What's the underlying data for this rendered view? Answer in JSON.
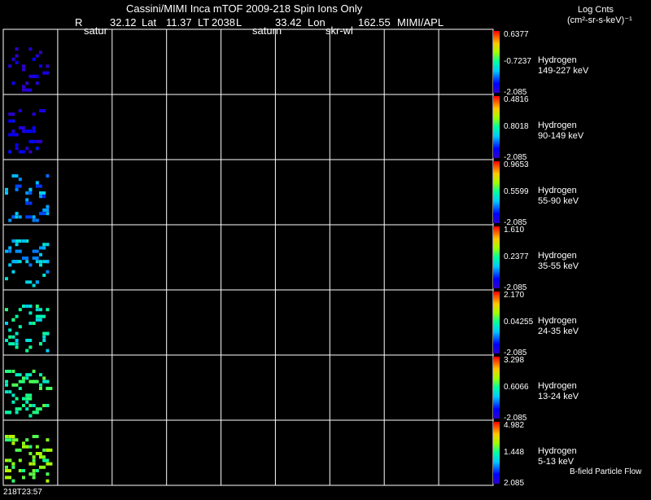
{
  "header": {
    "title": "Cassini/MIMI Inca mTOF  2009-218   Spin   Ions Only",
    "r_label": "R",
    "saturn_left": "satur",
    "r_value": "32.12",
    "lat_label": "Lat",
    "lat_value": "11.37",
    "lt_label": "LT",
    "lt_value": "2038",
    "l_label": "L",
    "saturn_mid": "saturn",
    "l_value": "33.42",
    "lon_label": "Lon",
    "skr_label": "skr-wl",
    "lon_value": "162.55",
    "org": "MIMI/APL"
  },
  "units": {
    "line1": "Log Cnts",
    "line2": "(cm²-sr-s-keV)⁻¹"
  },
  "footer": {
    "time": "218T23:57",
    "note": "B-field Particle Flow"
  },
  "chart_data": {
    "type": "heatmap",
    "grid_columns": 9,
    "colormap": "rainbow (blue→red)",
    "panels": [
      {
        "species": "Hydrogen",
        "energy": "149-227 keV",
        "max": "0.6377",
        "mid": "-0.7237",
        "min": "-2.085",
        "level": 0.05
      },
      {
        "species": "Hydrogen",
        "energy": "90-149 keV",
        "max": "0.4816",
        "mid": "0.8018",
        "min": "-2.085",
        "level": 0.08
      },
      {
        "species": "Hydrogen",
        "energy": "55-90 keV",
        "max": "0.9653",
        "mid": "0.5599",
        "min": "-2.085",
        "level": 0.28
      },
      {
        "species": "Hydrogen",
        "energy": "35-55 keV",
        "max": "1.610",
        "mid": "0.2377",
        "min": "-2.085",
        "level": 0.35
      },
      {
        "species": "Hydrogen",
        "energy": "24-35 keV",
        "max": "2.170",
        "mid": "0.04255",
        "min": "-2.085",
        "level": 0.45
      },
      {
        "species": "Hydrogen",
        "energy": "13-24 keV",
        "max": "3.298",
        "mid": "0.6066",
        "min": "-2.085",
        "level": 0.52
      },
      {
        "species": "Hydrogen",
        "energy": "5-13 keV",
        "max": "4.982",
        "mid": "1.448",
        "min": "2.085",
        "level": 0.6
      }
    ]
  }
}
